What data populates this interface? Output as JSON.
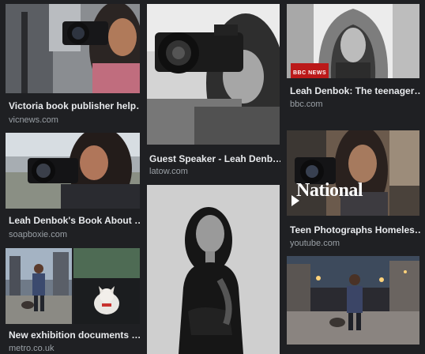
{
  "results": [
    {
      "title": "Victoria book publisher help…",
      "source": "vicnews.com"
    },
    {
      "title": "Guest Speaker - Leah Denb…",
      "source": "latow.com"
    },
    {
      "title": "Leah Denbok: The teenager…",
      "source": "bbc.com",
      "badge": "BBC NEWS"
    },
    {
      "title": "Leah Denbok's Book About …",
      "source": "soapboxie.com"
    },
    {
      "title": "Teen Photographs Homeles…",
      "source": "youtube.com",
      "overlay": "National"
    },
    {
      "title": "New exhibition documents …",
      "source": "metro.co.uk"
    },
    {
      "title": "",
      "source": ""
    },
    {
      "title": "",
      "source": ""
    }
  ]
}
